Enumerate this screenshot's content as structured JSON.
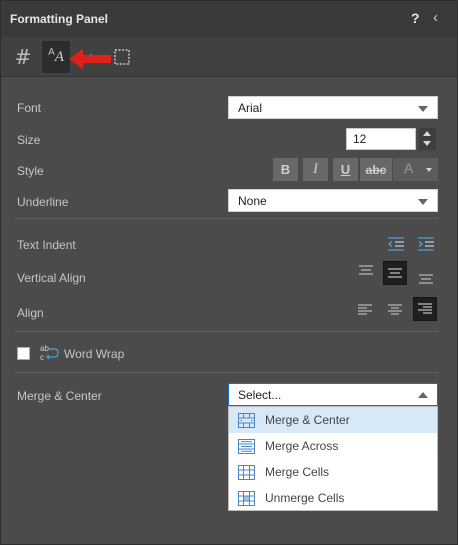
{
  "panel": {
    "title": "Formatting Panel",
    "help_label": "?",
    "collapse_glyph": "‹"
  },
  "tabs": [
    {
      "name": "number-format",
      "glyph": "#"
    },
    {
      "name": "text-format",
      "glyph_big": "A",
      "glyph_small": "A"
    },
    {
      "name": "cell-fill",
      "glyph": "•"
    },
    {
      "name": "cell-borders"
    }
  ],
  "font": {
    "label": "Font",
    "value": "Arial"
  },
  "size": {
    "label": "Size",
    "value": "12"
  },
  "style": {
    "label": "Style",
    "bold": "B",
    "italic": "I",
    "underline": "U",
    "strike": "abc",
    "color_glyph": "A"
  },
  "underline": {
    "label": "Underline",
    "value": "None"
  },
  "text_indent": {
    "label": "Text Indent"
  },
  "vertical_align": {
    "label": "Vertical Align",
    "selected": "middle"
  },
  "align": {
    "label": "Align",
    "selected": "right"
  },
  "word_wrap": {
    "label": "Word Wrap",
    "checked": false,
    "icon_text_top": "ab",
    "icon_text_bottom": "c"
  },
  "merge": {
    "label": "Merge & Center",
    "placeholder": "Select...",
    "options": [
      {
        "label": "Merge & Center"
      },
      {
        "label": "Merge Across"
      },
      {
        "label": "Merge Cells"
      },
      {
        "label": "Unmerge Cells"
      }
    ]
  },
  "colors": {
    "accent_arrow": "#e0201b",
    "focus_blue": "#0a74d0",
    "highlight": "#d7e9f7"
  }
}
